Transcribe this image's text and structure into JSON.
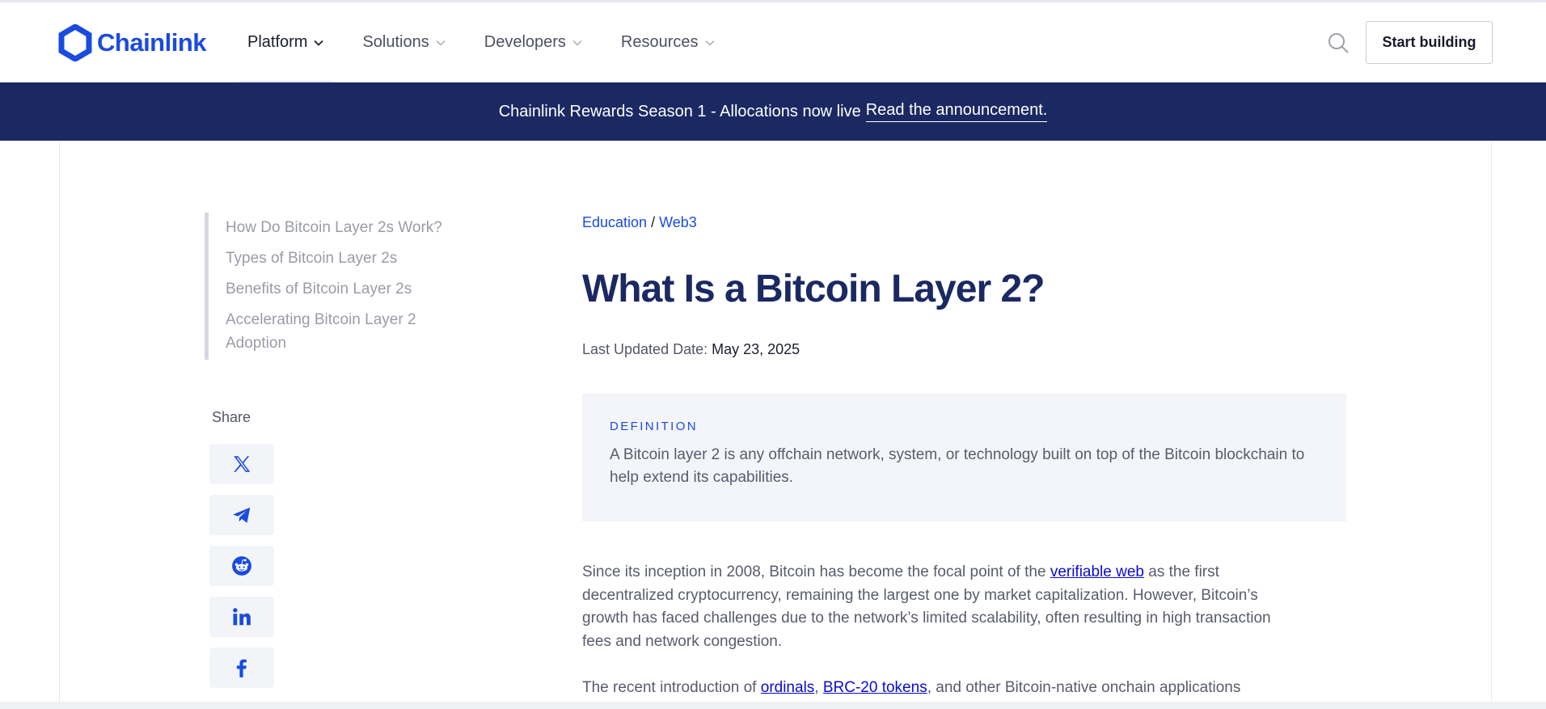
{
  "header": {
    "logo_text": "Chainlink",
    "nav": [
      {
        "label": "Platform"
      },
      {
        "label": "Solutions"
      },
      {
        "label": "Developers"
      },
      {
        "label": "Resources"
      }
    ],
    "cta_label": "Start building"
  },
  "banner": {
    "text": "Chainlink Rewards Season 1 - Allocations now live",
    "link": "Read the announcement."
  },
  "toc": [
    "How Do Bitcoin Layer 2s Work?",
    "Types of Bitcoin Layer 2s",
    "Benefits of Bitcoin Layer 2s",
    "Accelerating Bitcoin Layer 2 Adoption"
  ],
  "share": {
    "label": "Share",
    "buttons": [
      "x-icon",
      "telegram-icon",
      "reddit-icon",
      "linkedin-icon",
      "facebook-icon"
    ]
  },
  "article": {
    "breadcrumb": {
      "first": "Education",
      "separator": "/",
      "second": "Web3"
    },
    "title": "What Is a Bitcoin Layer 2?",
    "updated_label": "Last Updated Date:",
    "updated_date": "May 23, 2025",
    "definition_label": "DEFINITION",
    "definition_text": "A Bitcoin layer 2 is any offchain network, system, or technology built on top of the Bitcoin blockchain to help extend its capabilities.",
    "para1": {
      "before": "Since its inception in 2008, Bitcoin has become the focal point of the ",
      "link": "verifiable web",
      "after": " as the first decentralized cryptocurrency, remaining the largest one by market capitalization. However, Bitcoin’s growth has faced challenges due to the network’s limited scalability, often resulting in high transaction fees and network congestion."
    },
    "para2": {
      "before": "The recent introduction of ",
      "link1": "ordinals",
      "comma": ", ",
      "link2": "BRC-20 tokens",
      "after": ", and other Bitcoin-native onchain applications"
    }
  },
  "colors": {
    "brand_blue": "#1a4be0",
    "banner_navy": "#1b2963",
    "title_navy": "#1b2963"
  }
}
